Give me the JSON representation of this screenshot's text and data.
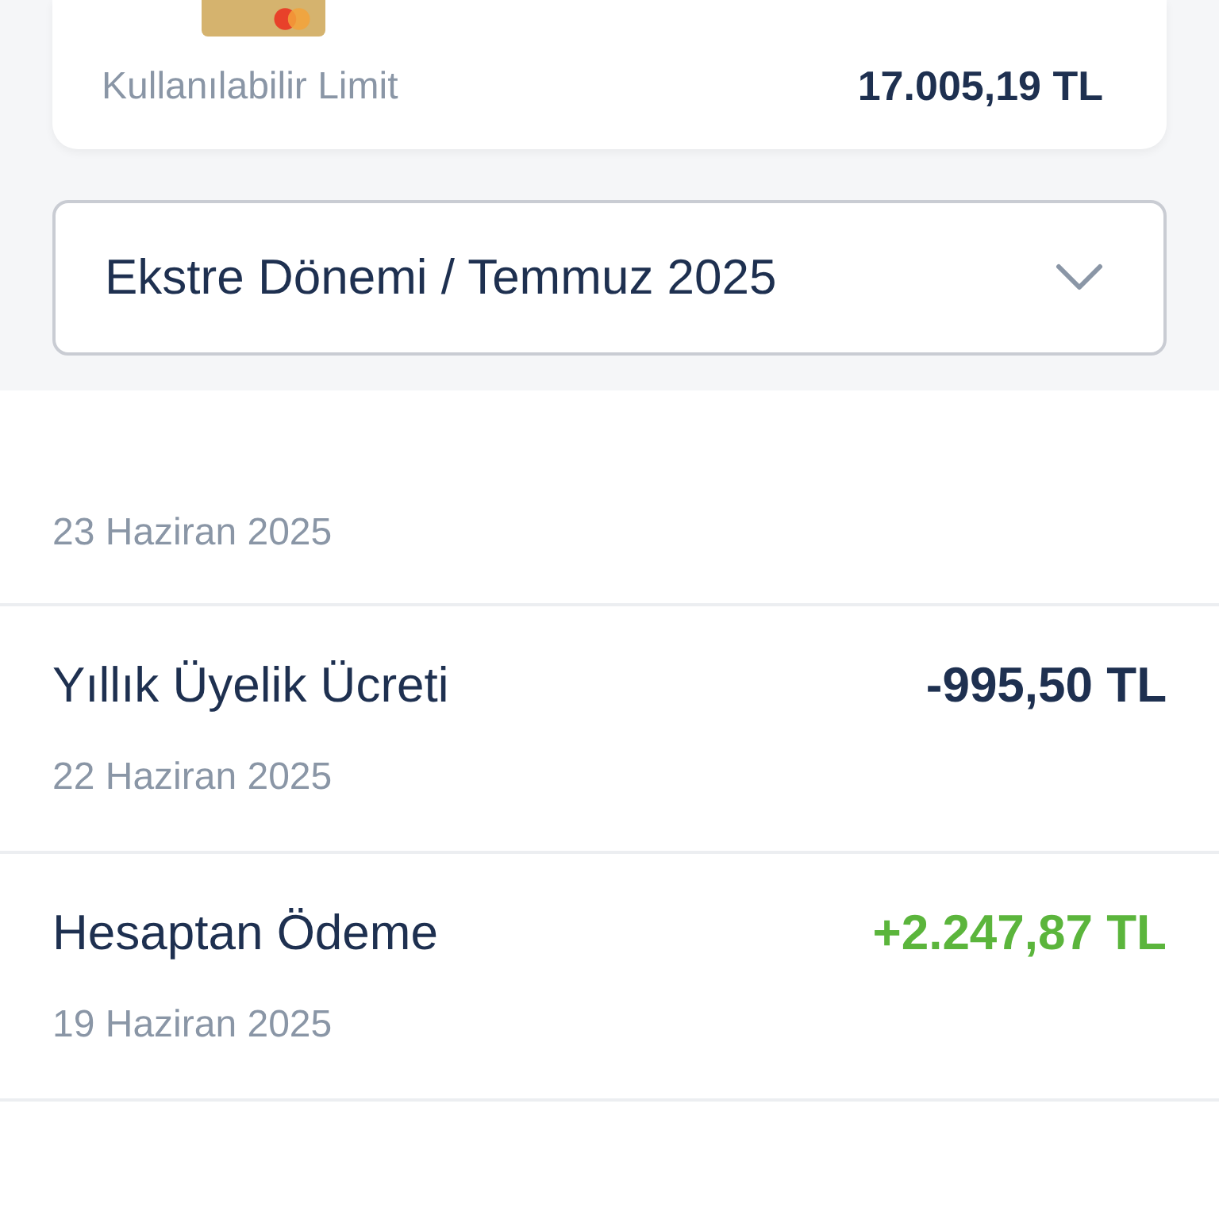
{
  "card_summary": {
    "label": "Kullanılabilir Limit",
    "value": "17.005,19 TL"
  },
  "period_dropdown": {
    "value": "Ekstre Dönemi / Temmuz 2025",
    "expanded": false
  },
  "transactions": [
    {
      "date": "23 Haziran 2025"
    },
    {
      "title": "Yıllık Üyelik Ücreti",
      "amount": "-995,50 TL",
      "kind": "debit",
      "date": "22 Haziran 2025"
    },
    {
      "title": "Hesaptan Ödeme",
      "amount": "+2.247,87 TL",
      "kind": "credit",
      "date": "19 Haziran 2025"
    }
  ]
}
